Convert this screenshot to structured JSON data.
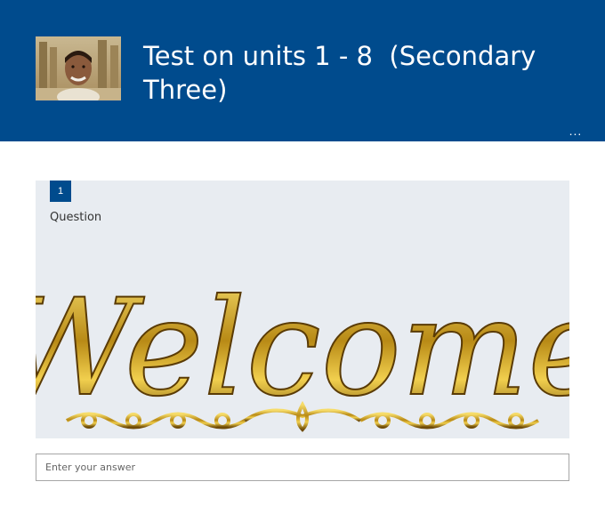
{
  "header": {
    "title": "Test on units 1 - 8  (Secondary Three)",
    "more_label": "...",
    "background_color": "#004b8d",
    "avatar_icon": "profile-photo"
  },
  "question": {
    "number": "1",
    "label": "Question",
    "image_text": "Welcome",
    "card_color": "#e8ecf1"
  },
  "answer": {
    "placeholder": "Enter your answer",
    "value": ""
  }
}
